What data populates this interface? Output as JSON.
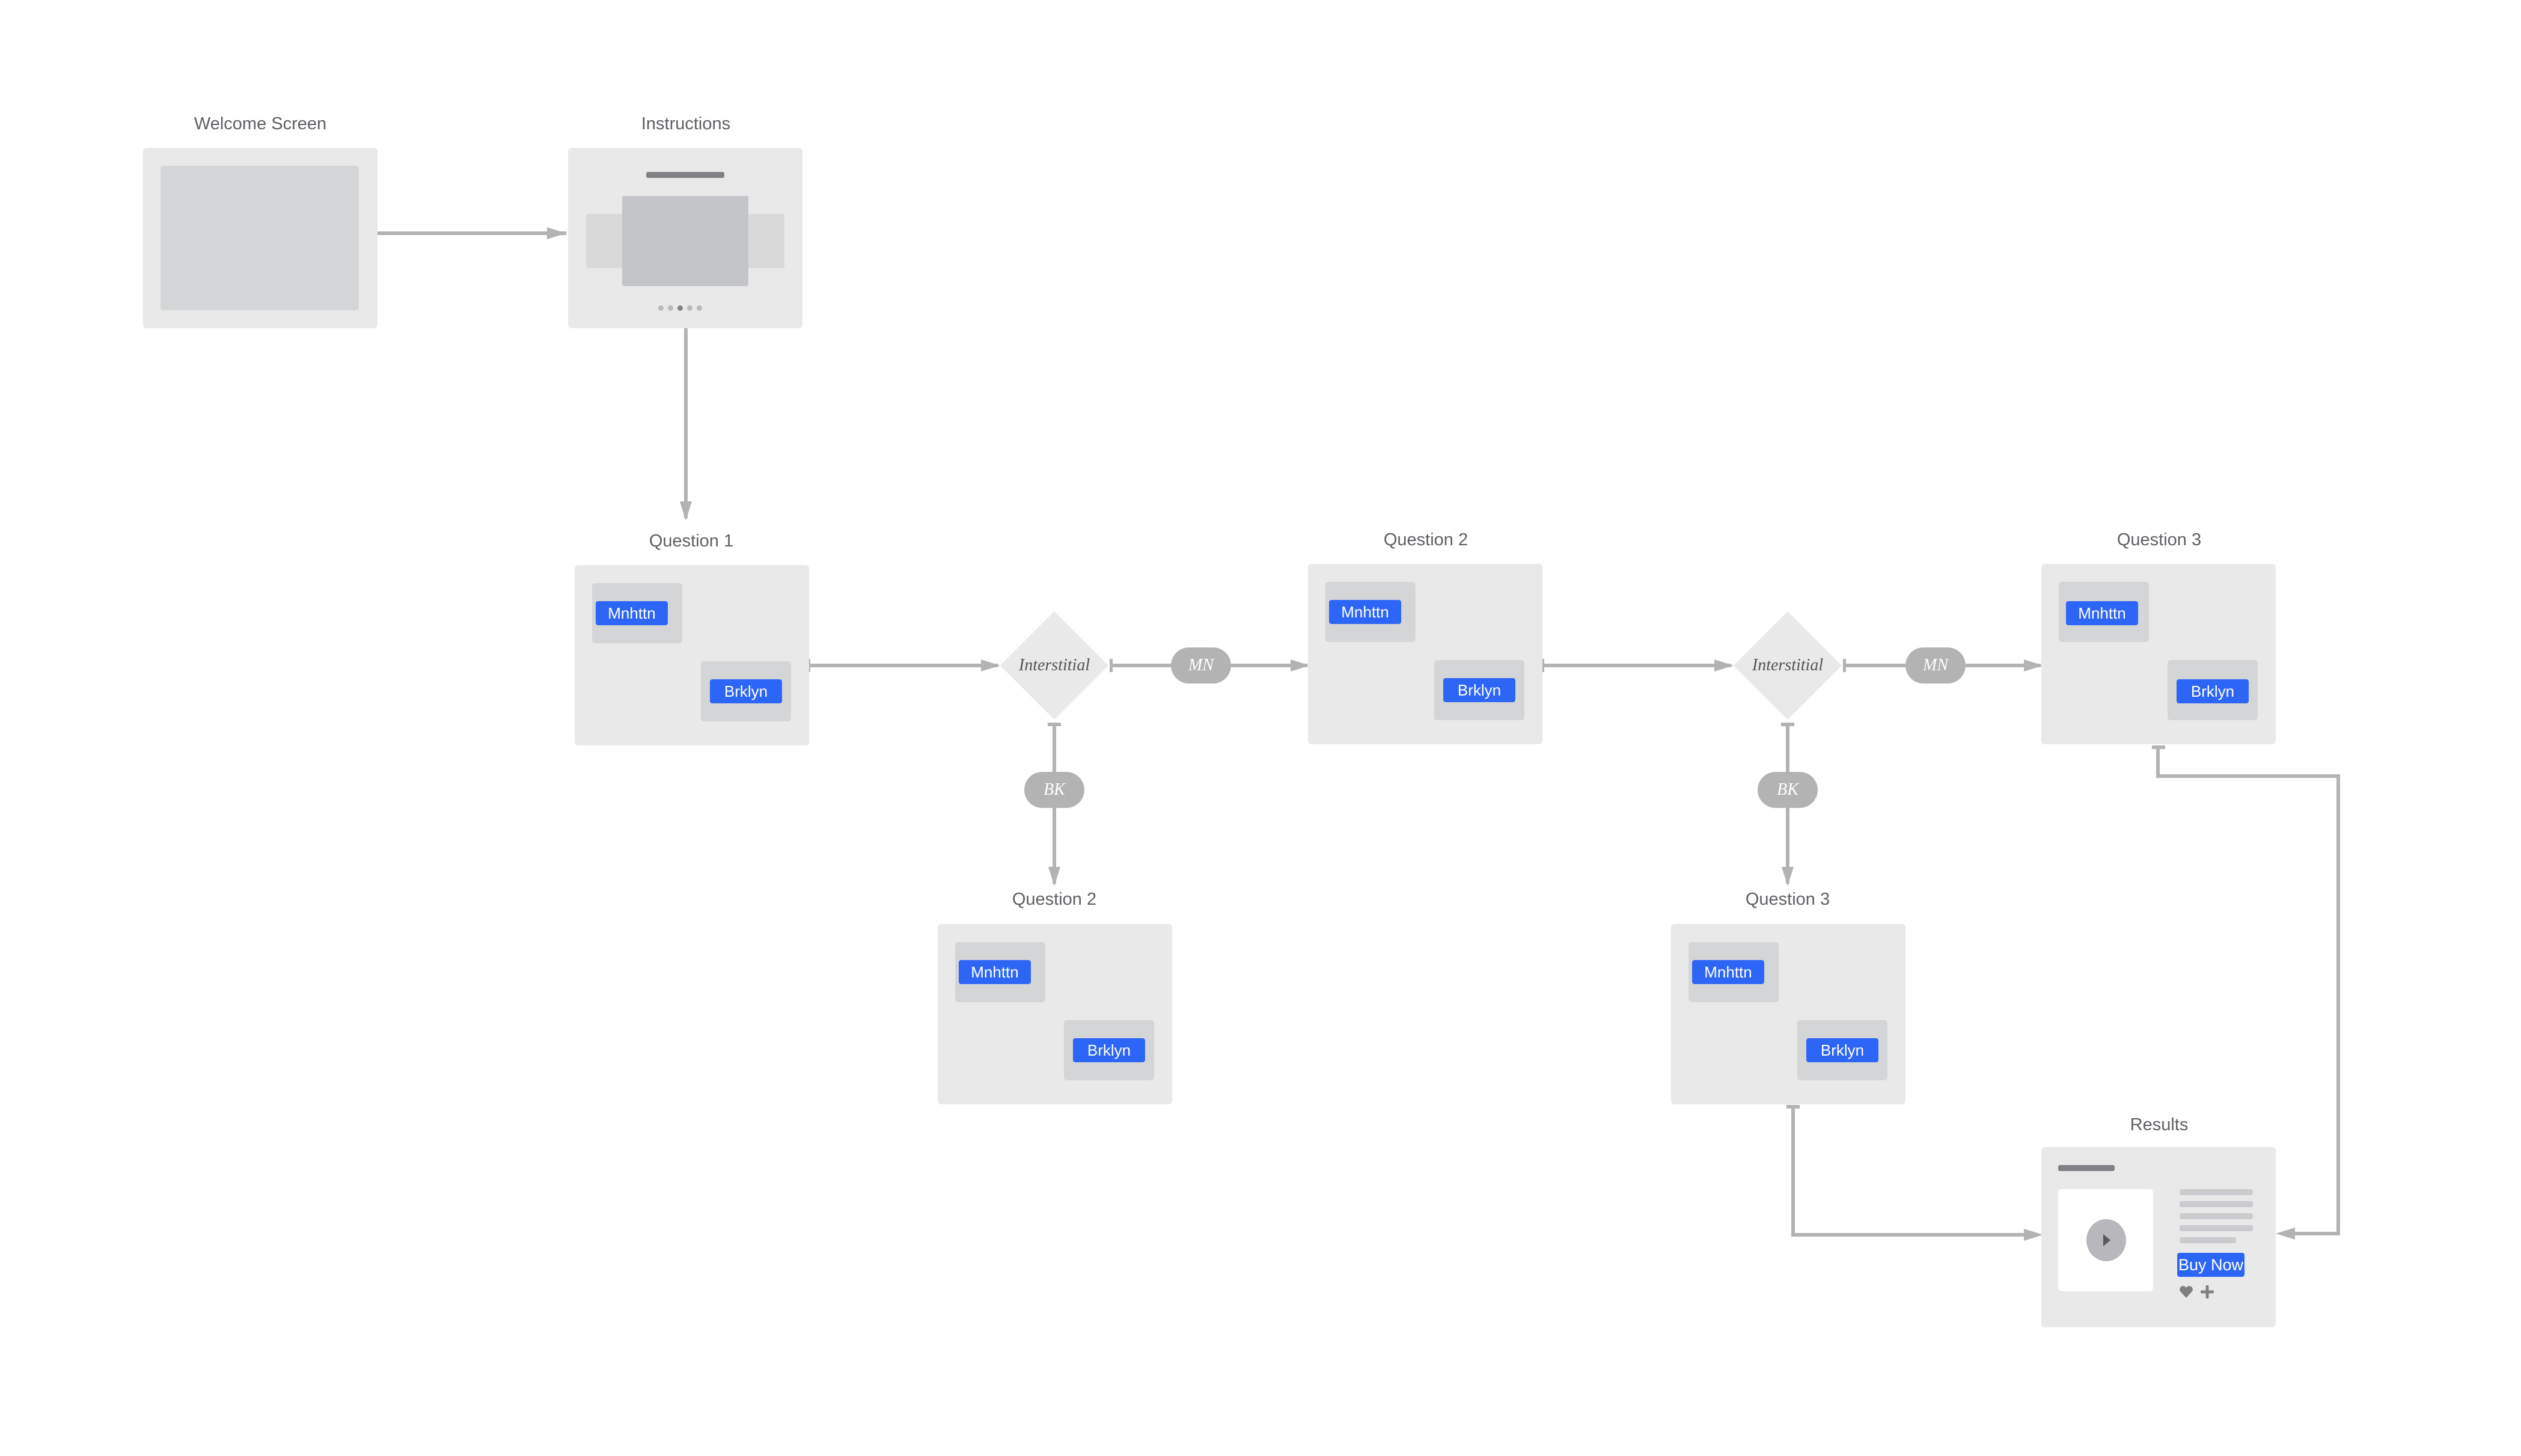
{
  "nodes": {
    "welcome": {
      "title": "Welcome Screen"
    },
    "instructions": {
      "title": "Instructions"
    },
    "q1": {
      "title": "Question 1",
      "options": [
        "Mnhttn",
        "Brklyn"
      ]
    },
    "q2a": {
      "title": "Question 2",
      "options": [
        "Mnhttn",
        "Brklyn"
      ]
    },
    "q2b": {
      "title": "Question 2",
      "options": [
        "Mnhttn",
        "Brklyn"
      ]
    },
    "q3a": {
      "title": "Question 3",
      "options": [
        "Mnhttn",
        "Brklyn"
      ]
    },
    "q3b": {
      "title": "Question 3",
      "options": [
        "Mnhttn",
        "Brklyn"
      ]
    },
    "results": {
      "title": "Results",
      "cta": "Buy Now",
      "icons": [
        "play-icon",
        "heart-icon",
        "plus-icon"
      ]
    }
  },
  "decisions": {
    "d1": {
      "label": "Interstitial",
      "mn": "MN",
      "bk": "BK"
    },
    "d2": {
      "label": "Interstitial",
      "mn": "MN",
      "bk": "BK"
    }
  },
  "colors": {
    "accent": "#2d66f6",
    "card": "#e9e9e9",
    "connector": "#b3b3b3",
    "label": "#5f6064"
  }
}
